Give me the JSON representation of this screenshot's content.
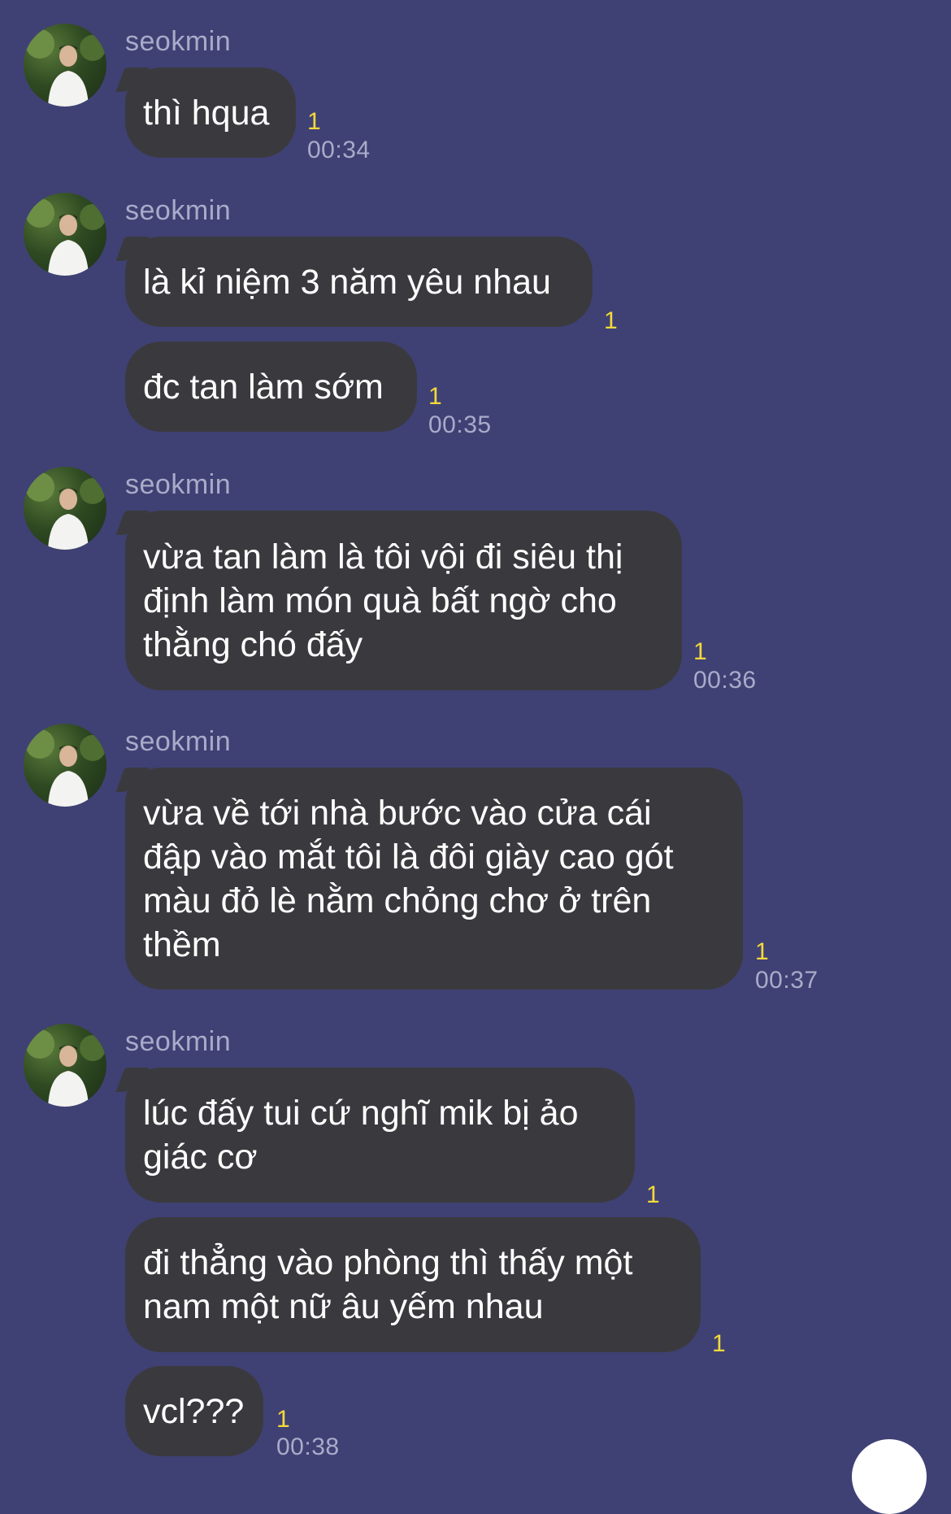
{
  "chat": {
    "groups": [
      {
        "sender": "seokmin",
        "messages": [
          {
            "text": "thì hqua",
            "read": "1",
            "time": "00:34"
          }
        ]
      },
      {
        "sender": "seokmin",
        "messages": [
          {
            "text": "là kỉ niệm 3 năm yêu nhau",
            "read": "1",
            "time": ""
          },
          {
            "text": "đc tan làm sớm",
            "read": "1",
            "time": "00:35"
          }
        ]
      },
      {
        "sender": "seokmin",
        "messages": [
          {
            "text": "vừa tan làm là tôi vội đi siêu thị\nđịnh làm món quà bất ngờ cho\nthằng chó đấy",
            "read": "1",
            "time": "00:36"
          }
        ]
      },
      {
        "sender": "seokmin",
        "messages": [
          {
            "text": "vừa về tới nhà bước vào cửa cái\nđập vào mắt tôi là đôi giày cao gót\nmàu đỏ lè nằm chỏng chơ ở trên\nthềm",
            "read": "1",
            "time": "00:37"
          }
        ]
      },
      {
        "sender": "seokmin",
        "messages": [
          {
            "text": "lúc đấy tui cứ nghĩ mik bị ảo\ngiác cơ",
            "read": "1",
            "time": ""
          },
          {
            "text": "đi thẳng vào phòng thì thấy một\nnam một nữ âu yếm nhau",
            "read": "1",
            "time": ""
          },
          {
            "text": "vcl???",
            "read": "1",
            "time": "00:38"
          }
        ]
      }
    ]
  },
  "colors": {
    "background": "#3f4174",
    "bubble": "#3a3a3e",
    "read_indicator": "#f4d93a",
    "meta_text": "#a9abc9"
  }
}
